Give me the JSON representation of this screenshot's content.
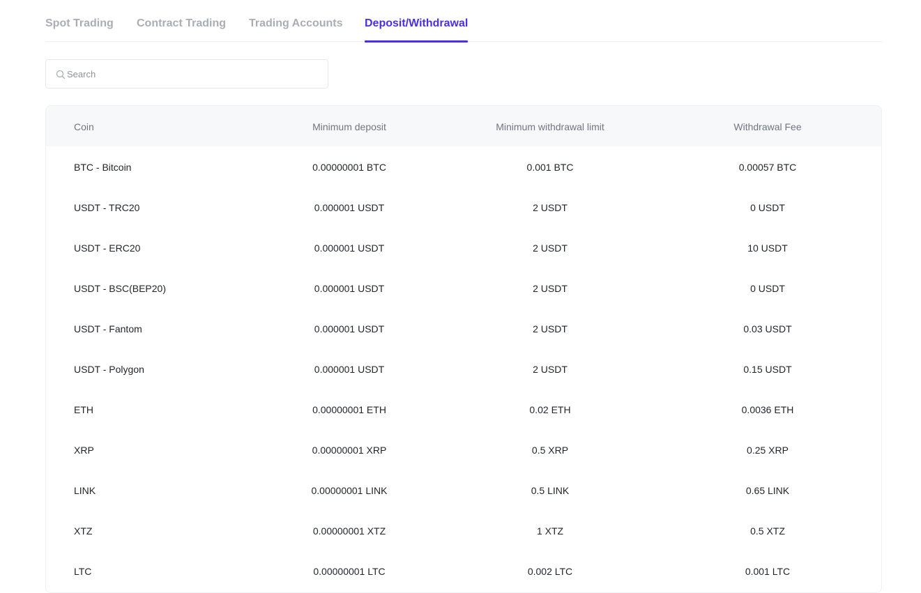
{
  "tabs": [
    {
      "label": "Spot Trading"
    },
    {
      "label": "Contract Trading"
    },
    {
      "label": "Trading Accounts"
    },
    {
      "label": "Deposit/Withdrawal",
      "active": true
    }
  ],
  "search": {
    "placeholder": "Search",
    "value": ""
  },
  "table": {
    "headers": [
      "Coin",
      "Minimum deposit",
      "Minimum withdrawal limit",
      "Withdrawal Fee"
    ],
    "rows": [
      [
        "BTC - Bitcoin",
        "0.00000001 BTC",
        "0.001 BTC",
        "0.00057 BTC"
      ],
      [
        "USDT - TRC20",
        "0.000001 USDT",
        "2 USDT",
        "0 USDT"
      ],
      [
        "USDT - ERC20",
        "0.000001 USDT",
        "2 USDT",
        "10 USDT"
      ],
      [
        "USDT - BSC(BEP20)",
        "0.000001 USDT",
        "2 USDT",
        "0 USDT"
      ],
      [
        "USDT - Fantom",
        "0.000001 USDT",
        "2 USDT",
        "0.03 USDT"
      ],
      [
        "USDT - Polygon",
        "0.000001 USDT",
        "2 USDT",
        "0.15 USDT"
      ],
      [
        "ETH",
        "0.00000001 ETH",
        "0.02 ETH",
        "0.0036 ETH"
      ],
      [
        "XRP",
        "0.00000001 XRP",
        "0.5 XRP",
        "0.25 XRP"
      ],
      [
        "LINK",
        "0.00000001 LINK",
        "0.5 LINK",
        "0.65 LINK"
      ],
      [
        "XTZ",
        "0.00000001 XTZ",
        "1 XTZ",
        "0.5 XTZ"
      ],
      [
        "LTC",
        "0.00000001 LTC",
        "0.002 LTC",
        "0.001 LTC"
      ]
    ]
  },
  "colors": {
    "accent": "#4a2fe3",
    "tab_inactive": "#a9aeb6",
    "header_bg": "#f7f8fa",
    "text": "#1f2329"
  },
  "icons": {
    "search": "search-icon"
  }
}
